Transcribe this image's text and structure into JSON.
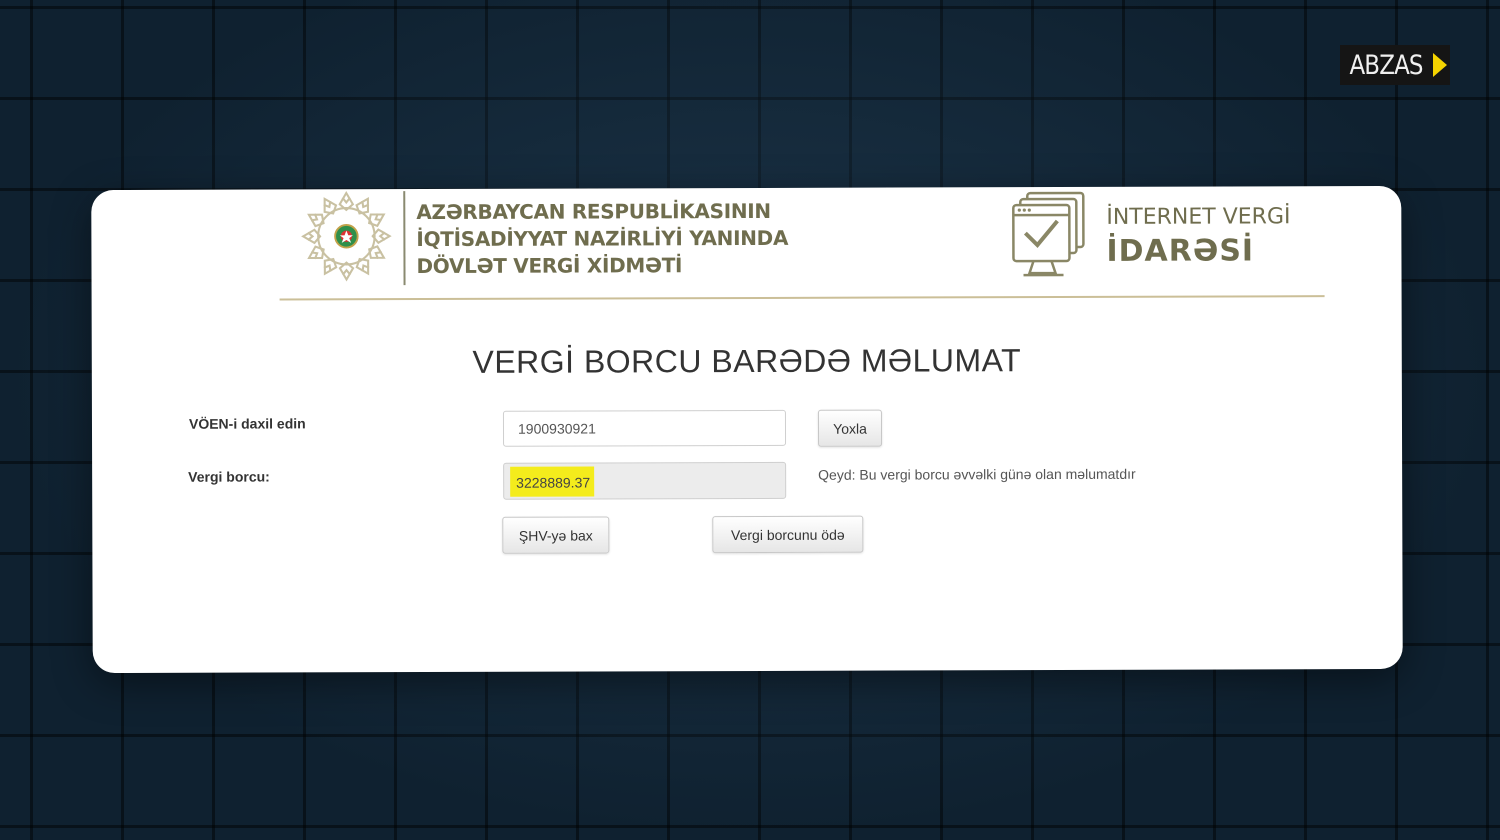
{
  "overlay": {
    "brand": "ABZAS",
    "accent": "#f5d300"
  },
  "header": {
    "agency_lines": [
      "AZƏRBAYCAN RESPUBLİKASININ",
      "İQTİSADİYYAT NAZİRLİYİ YANINDA",
      "DÖVLƏT VERGİ XİDMƏTİ"
    ],
    "service_line1": "İNTERNET VERGİ",
    "service_line2": "İDARƏSİ",
    "text_color": "#6f6d4e"
  },
  "form": {
    "title": "VERGİ BORCU BARƏDƏ MƏLUMAT",
    "voen_label": "VÖEN-i daxil edin",
    "voen_value": "1900930921",
    "check_button": "Yoxla",
    "debt_label": "Vergi borcu:",
    "debt_value": "3228889.37",
    "debt_note": "Qeyd: Bu vergi borcu əvvəlki günə olan məlumatdır",
    "shv_button": "ŞHV-yə bax",
    "pay_button": "Vergi borcunu ödə",
    "highlight_color": "#f4ec1c"
  }
}
